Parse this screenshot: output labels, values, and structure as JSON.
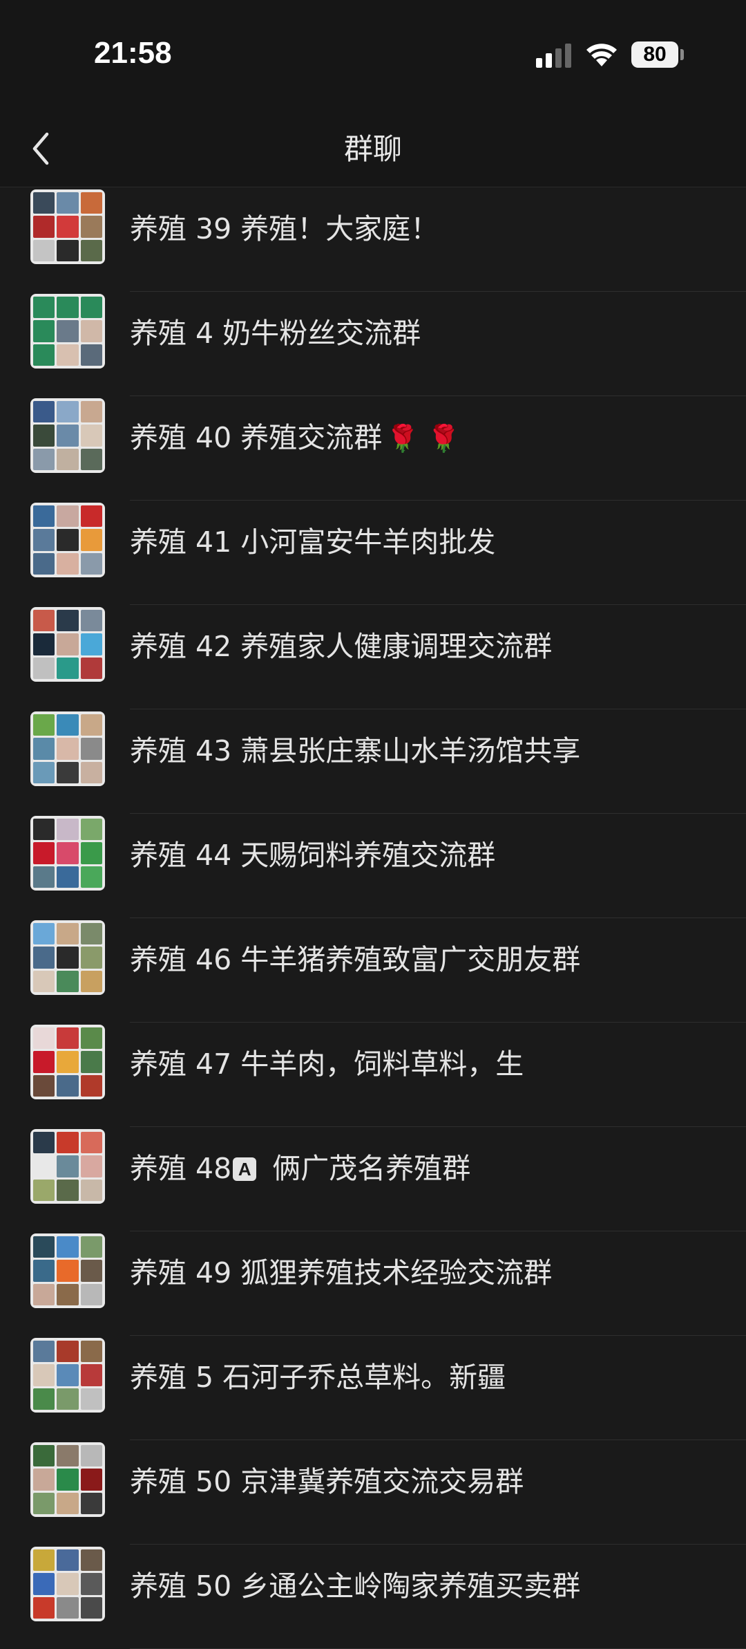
{
  "status": {
    "time": "21:58",
    "battery": "80"
  },
  "nav": {
    "title": "群聊"
  },
  "groups": [
    {
      "name": "养殖 39 养殖！大家庭！",
      "colors": [
        "#3a4a5a",
        "#6a8aa8",
        "#c86a3a",
        "#b02a2a",
        "#d23a3a",
        "#9a7a5a",
        "#c4c4c4",
        "#2a2a2a",
        "#5a6a4a"
      ]
    },
    {
      "name": "养殖 4 奶牛粉丝交流群",
      "colors": [
        "#2a8a5a",
        "#2a8a5a",
        "#2a8a5a",
        "#2a8a5a",
        "#6a7a8a",
        "#d0b8a8",
        "#2a8a5a",
        "#d8c0b0",
        "#5a6a7a"
      ]
    },
    {
      "name": "养殖 40 养殖交流群",
      "emoji": "🌹 🌹",
      "colors": [
        "#3a5a8a",
        "#8aa8c8",
        "#c8a890",
        "#3a4a3a",
        "#6a8aa8",
        "#d8c8b8",
        "#8a9aaa",
        "#c0b0a0",
        "#5a6a5a"
      ]
    },
    {
      "name": "养殖 41 小河富安牛羊肉批发",
      "colors": [
        "#3a6a9a",
        "#c8a8a0",
        "#c82a2a",
        "#5a7a9a",
        "#2a2a2a",
        "#e89a3a",
        "#4a6a8a",
        "#d8b0a0",
        "#8a9aaa"
      ]
    },
    {
      "name": "养殖 42 养殖家人健康调理交流群",
      "colors": [
        "#c85a4a",
        "#2a3a4a",
        "#7a8a9a",
        "#1a2a3a",
        "#c8a898",
        "#4aa8d8",
        "#c0c0c0",
        "#2a9a8a",
        "#b03a3a"
      ]
    },
    {
      "name": "养殖 43 萧县张庄寨山水羊汤馆共享",
      "colors": [
        "#6aa84a",
        "#3a8ab8",
        "#c8a888",
        "#5a8aa8",
        "#d8b8a8",
        "#8a8a8a",
        "#6a9ab8",
        "#3a3a3a",
        "#c8b0a0"
      ]
    },
    {
      "name": "养殖 44 天赐饲料养殖交流群",
      "colors": [
        "#2a2a2a",
        "#c8b8c8",
        "#7aa86a",
        "#c81a2a",
        "#d84a6a",
        "#3a9a4a",
        "#5a7a8a",
        "#3a6a9a",
        "#4aa85a"
      ]
    },
    {
      "name": "养殖 46 牛羊猪养殖致富广交朋友群",
      "colors": [
        "#6aa8d8",
        "#c8a888",
        "#7a8a6a",
        "#4a6a8a",
        "#2a2a2a",
        "#8a9a6a",
        "#d8c8b8",
        "#4a8a5a",
        "#c8a060"
      ]
    },
    {
      "name": "养殖 47 牛羊肉，饲料草料，生",
      "colors": [
        "#e8d8d8",
        "#c83a3a",
        "#5a8a4a",
        "#c81a2a",
        "#e8a83a",
        "#4a7a4a",
        "#6a4a3a",
        "#4a6a8a",
        "#b03a2a"
      ]
    },
    {
      "name": "养殖 48",
      "badge": "A",
      "suffix": " 俩广茂名养殖群",
      "colors": [
        "#2a3a4a",
        "#c83a2a",
        "#d86a5a",
        "#e8e8e8",
        "#6a8a9a",
        "#d8a8a0",
        "#9aa86a",
        "#5a6a4a",
        "#c8b8a8"
      ]
    },
    {
      "name": "养殖 49 狐狸养殖技术经验交流群",
      "colors": [
        "#2a4a5a",
        "#4a8ac8",
        "#7a9a6a",
        "#3a6a8a",
        "#e86a2a",
        "#6a5a4a",
        "#c8a898",
        "#8a6a4a",
        "#b8b8b8"
      ]
    },
    {
      "name": "养殖 5 石河子乔总草料。新疆",
      "colors": [
        "#5a7a9a",
        "#a83a2a",
        "#8a6a4a",
        "#d8c8b8",
        "#5a8ab8",
        "#b83a3a",
        "#4a8a4a",
        "#7a9a6a",
        "#c0c0c0"
      ]
    },
    {
      "name": "养殖 50 京津冀养殖交流交易群",
      "colors": [
        "#3a6a3a",
        "#8a7a6a",
        "#b8b8b8",
        "#c8a898",
        "#2a8a4a",
        "#8a1a1a",
        "#7a9a6a",
        "#c8a888",
        "#3a3a3a"
      ]
    },
    {
      "name": "养殖 50 乡通公主岭陶家养殖买卖群",
      "colors": [
        "#c8a83a",
        "#4a6a9a",
        "#6a5a4a",
        "#3a6ab8",
        "#d8c8b8",
        "#5a5a5a",
        "#c83a2a",
        "#8a8a8a",
        "#4a4a4a"
      ]
    }
  ]
}
